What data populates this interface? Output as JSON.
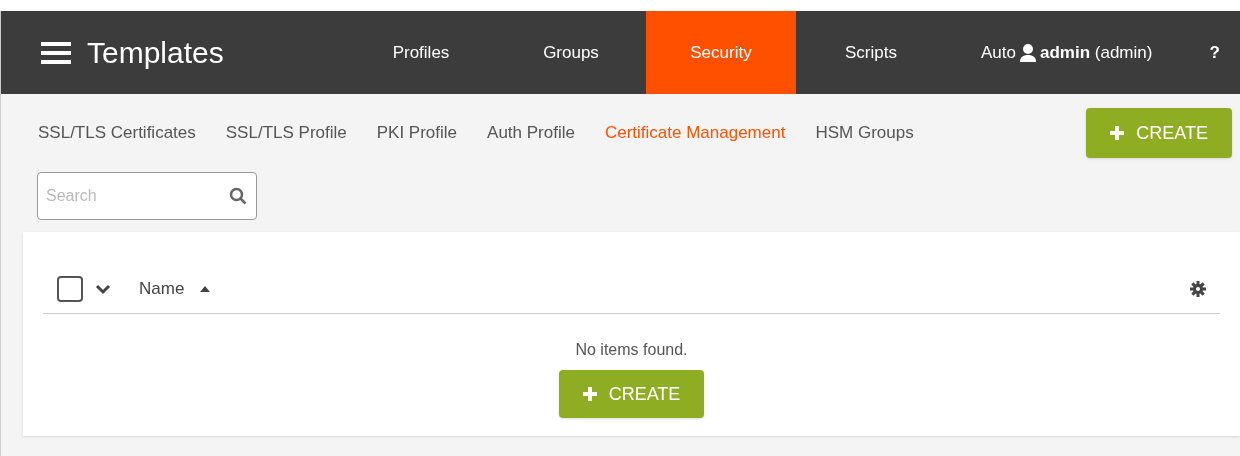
{
  "header": {
    "title": "Templates",
    "tabs": [
      {
        "label": "Profiles",
        "selected": false
      },
      {
        "label": "Groups",
        "selected": false
      },
      {
        "label": "Security",
        "selected": true
      },
      {
        "label": "Scripts",
        "selected": false
      },
      {
        "label": "Auto",
        "selected": false
      }
    ],
    "user": {
      "name": "admin",
      "role": "(admin)"
    },
    "help": "?"
  },
  "subtabs": [
    {
      "label": "SSL/TLS Certificates",
      "selected": false
    },
    {
      "label": "SSL/TLS Profile",
      "selected": false
    },
    {
      "label": "PKI Profile",
      "selected": false
    },
    {
      "label": "Auth Profile",
      "selected": false
    },
    {
      "label": "Certificate Management",
      "selected": true
    },
    {
      "label": "HSM Groups",
      "selected": false
    }
  ],
  "create_button": "CREATE",
  "search": {
    "placeholder": "Search"
  },
  "table": {
    "select_all": {
      "checked": false
    },
    "columns": [
      {
        "label": "Name",
        "sorted_ascending": true
      }
    ],
    "empty_message": "No items found.",
    "create_button": "CREATE"
  }
}
